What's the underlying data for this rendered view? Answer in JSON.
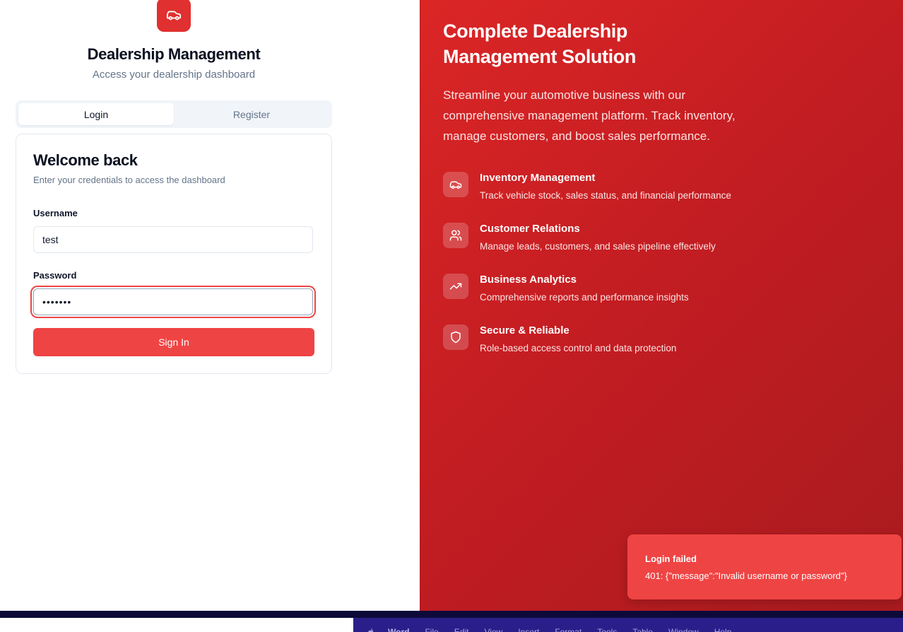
{
  "brand": {
    "title": "Dealership Management",
    "subtitle": "Access your dealership dashboard"
  },
  "tabs": {
    "login": "Login",
    "register": "Register"
  },
  "login_card": {
    "title": "Welcome back",
    "subtitle": "Enter your credentials to access the dashboard",
    "username_label": "Username",
    "username_value": "test",
    "password_label": "Password",
    "password_value": "•••••••",
    "submit_label": "Sign In"
  },
  "hero": {
    "title": "Complete Dealership Management Solution",
    "description": "Streamline your automotive business with our comprehensive management platform. Track inventory, manage customers, and boost sales performance.",
    "features": [
      {
        "icon": "car-icon",
        "title": "Inventory Management",
        "description": "Track vehicle stock, sales status, and financial performance"
      },
      {
        "icon": "users-icon",
        "title": "Customer Relations",
        "description": "Manage leads, customers, and sales pipeline effectively"
      },
      {
        "icon": "trending-up-icon",
        "title": "Business Analytics",
        "description": "Comprehensive reports and performance insights"
      },
      {
        "icon": "shield-icon",
        "title": "Secure & Reliable",
        "description": "Role-based access control and data protection"
      }
    ]
  },
  "toast": {
    "title": "Login failed",
    "message": "401: {\"message\":\"Invalid username or password\"}"
  },
  "menubar": {
    "app": "Word",
    "items": [
      "File",
      "Edit",
      "View",
      "Insert",
      "Format",
      "Tools",
      "Table",
      "Window",
      "Help"
    ]
  },
  "colors": {
    "brand_red": "#ef4444",
    "hero_gradient_start": "#dc2626",
    "hero_gradient_end": "#a91b1f"
  }
}
